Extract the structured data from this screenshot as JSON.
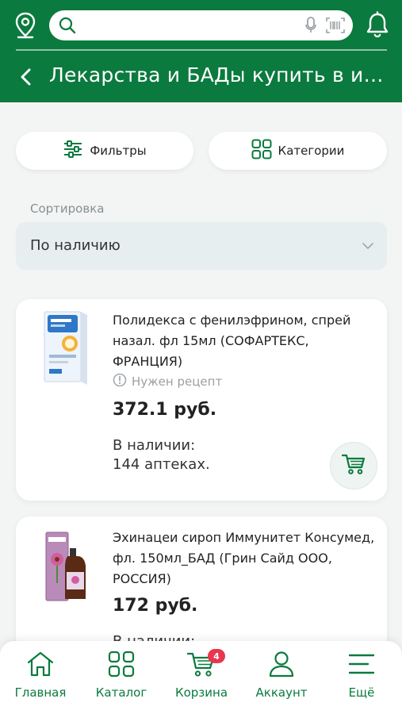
{
  "header": {
    "title": "Лекарства и БАДы купить в интернет-аптеке",
    "search": {
      "value": "",
      "placeholder": ""
    }
  },
  "filters": {
    "filters_label": "Фильтры",
    "categories_label": "Категории"
  },
  "sort": {
    "label": "Сортировка",
    "value": "По наличию"
  },
  "products": [
    {
      "name": "Полидекса с фенилэфрином, спрей назал. фл 15мл (СОФАРТЕКС, ФРАНЦИЯ)",
      "rx_note": "Нужен рецепт",
      "price": "372.1 руб.",
      "stock_label": "В наличии:",
      "stock_value": "144 аптеках."
    },
    {
      "name": "Эхинацеи сироп Иммунитет Консумед, фл. 150мл_БАД (Грин Сайд ООО, РОССИЯ)",
      "price": "172 руб.",
      "stock_label": "В наличии:"
    }
  ],
  "bottom_nav": {
    "items": [
      {
        "label": "Главная",
        "icon": "home-icon"
      },
      {
        "label": "Каталог",
        "icon": "grid-icon"
      },
      {
        "label": "Корзина",
        "icon": "cart-icon",
        "badge": "4"
      },
      {
        "label": "Аккаунт",
        "icon": "user-icon"
      },
      {
        "label": "Ещё",
        "icon": "menu-icon"
      }
    ]
  },
  "colors": {
    "brand_green": "#0b7a3e",
    "badge_red": "#e8364e",
    "background": "#f3f4f4"
  }
}
